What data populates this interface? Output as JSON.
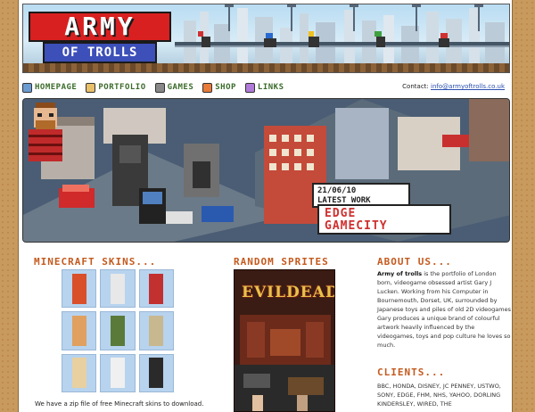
{
  "logo": {
    "line1": "ARMY",
    "line2": "OF TROLLS"
  },
  "nav": [
    {
      "label": "HOMEPAGE",
      "icon": "home-icon",
      "color": "#6b9bd1"
    },
    {
      "label": "PORTFOLIO",
      "icon": "palette-icon",
      "color": "#e8c06a"
    },
    {
      "label": "GAMES",
      "icon": "joystick-icon",
      "color": "#888888"
    },
    {
      "label": "SHOP",
      "icon": "basket-icon",
      "color": "#e87a3a"
    },
    {
      "label": "LINKS",
      "icon": "link-icon",
      "color": "#b07ad8"
    }
  ],
  "contact": {
    "label": "Contact:",
    "email": "info@armyoftrolls.co.uk"
  },
  "banner": {
    "date": "21/06/10",
    "caption": "LATEST WORK",
    "title_line1": "EDGE",
    "title_line2": "GAMECITY"
  },
  "minecraft": {
    "heading": "MINECRAFT SKINS...",
    "text": "We have a zip file of free Minecraft skins to download.",
    "skins": [
      {
        "name": "skin-1",
        "color": "#d94f2a"
      },
      {
        "name": "skin-2",
        "color": "#e8e8e8"
      },
      {
        "name": "skin-3",
        "color": "#c23030"
      },
      {
        "name": "skin-4",
        "color": "#e0a060"
      },
      {
        "name": "skin-5",
        "color": "#5a7a3a"
      },
      {
        "name": "skin-6",
        "color": "#c8b890"
      },
      {
        "name": "skin-7",
        "color": "#e8d0a0"
      },
      {
        "name": "skin-8",
        "color": "#f0f0f0"
      },
      {
        "name": "skin-9",
        "color": "#2a2a2a"
      }
    ]
  },
  "sprites": {
    "heading": "RANDOM SPRITES",
    "title": "EVILDEAD"
  },
  "about": {
    "heading": "ABOUT US...",
    "lead": "Army of trolls",
    "text": " is the portfolio of London born, videogame obsessed artist Gary J Lucken. Working from his Computer in Bournemouth, Dorset, UK, surrounded by Japanese toys and piles of old 2D videogames Gary produces a unique brand of colourful artwork heavily influenced by the videogames, toys and pop culture he loves so much."
  },
  "clients": {
    "heading": "CLIENTS...",
    "text": "BBC, HONDA, DISNEY, JC PENNEY, USTWO, SONY, EDGE, FHM, NHS, YAHOO, DORLING KINDERSLEY, WIRED, THE"
  }
}
